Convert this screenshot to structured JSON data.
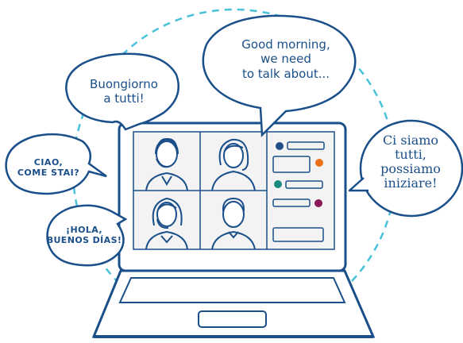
{
  "bubbles": {
    "italian_greeting": [
      "Buongiorno",
      "a tutti!"
    ],
    "english_greeting": [
      "Good morning,",
      "we need",
      "to talk about..."
    ],
    "italian_start": [
      "Ci siamo",
      "tutti,",
      "possiamo",
      "iniziare!"
    ],
    "ciao": [
      "CIAO,",
      "COME STAI?"
    ],
    "hola": [
      "¡HOLA,",
      "BUENOS DÍAS!"
    ]
  },
  "participants": [
    "man-with-headset",
    "woman",
    "woman-with-headset",
    "man"
  ],
  "chat_dots": [
    "#1a4f8a",
    "#e8701a",
    "#1a8a80",
    "#8a1a5a"
  ],
  "colors": {
    "outline": "#1a4f8a",
    "dashed_circle": "#48c2d8",
    "panel_fill": "#f3f3f3"
  }
}
